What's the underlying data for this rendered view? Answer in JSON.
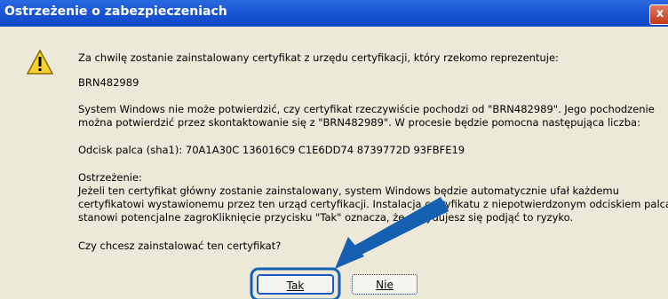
{
  "window": {
    "title": "Ostrzeżenie o zabezpieczeniach",
    "close_label": "x"
  },
  "dialog": {
    "intro": "Za chwilę zostanie zainstalowany certyfikat z urzędu certyfikacji, który rzekomo reprezentuje:",
    "issuer": "BRN482989",
    "verify_line1": "System Windows nie może potwierdzić, czy certyfikat rzeczywiście pochodzi od \"BRN482989\". Jego pochodzenie",
    "verify_line2": "można potwierdzić przez skontaktowanie się z \"BRN482989\". W procesie będzie pomocna następująca liczba:",
    "thumbprint": "Odcisk palca (sha1): 70A1A30C 136016C9 C1E6DD74 8739772D 93FBFE19",
    "warning_title": "Ostrzeżenie:",
    "warning_line1": "Jeżeli ten certyfikat główny zostanie zainstalowany, system Windows będzie automatycznie ufał każdemu",
    "warning_line2": "certyfikatowi wystawionemu przez ten urząd certyfikacji. Instalacja certyfikatu z niepotwierdzonym odciskiem palca",
    "warning_line3": "stanowi potencjalne zagroKliknięcie przycisku \"Tak\" oznacza, że decydujesz się podjąć to ryzyko.",
    "question": "Czy chcesz zainstalować ten certyfikat?",
    "yes_label": "Tak",
    "no_label": "Nie"
  },
  "colors": {
    "titlebar": "#1a56d6",
    "annotation_arrow": "#1560b0",
    "dialog_bg": "#ece9d8"
  },
  "icons": {
    "warning": "warning-triangle-icon",
    "close": "close-icon",
    "annotation": "arrow-pointer-icon"
  }
}
